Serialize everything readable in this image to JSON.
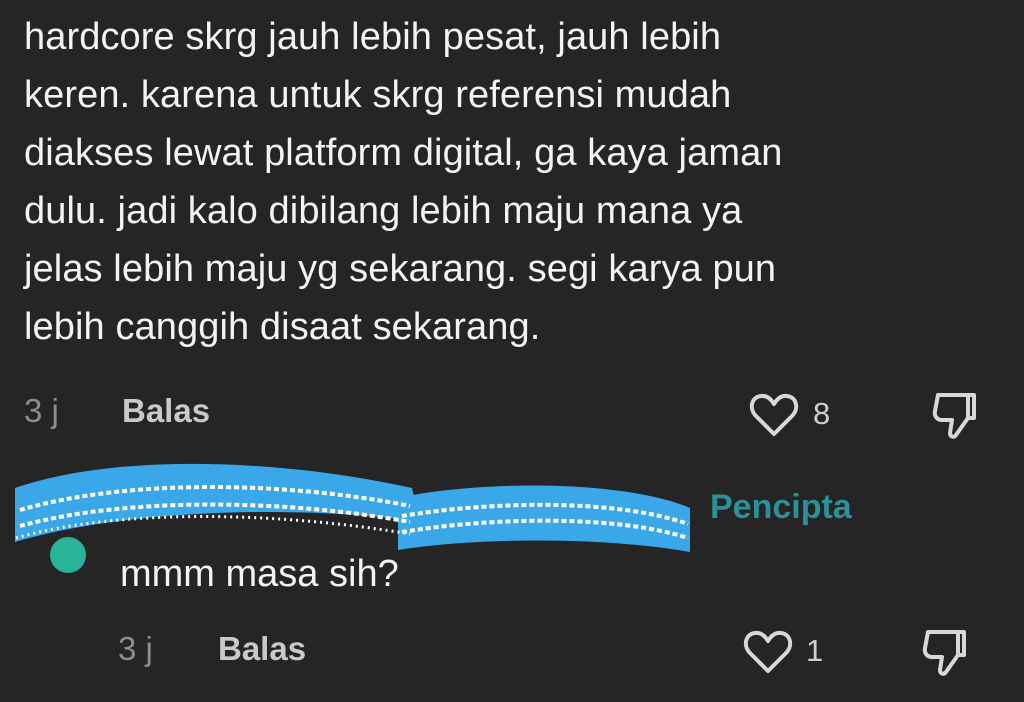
{
  "comment": {
    "text": "hardcore skrg jauh lebih pesat, jauh lebih\nkeren. karena untuk skrg referensi mudah\ndiakses lewat platform digital, ga kaya jaman\ndulu. jadi kalo dibilang lebih maju mana ya\njelas lebih maju yg sekarang. segi karya pun\nlebih canggih disaat sekarang.",
    "time": "3 j",
    "reply_label": "Balas",
    "likes": "8"
  },
  "reply": {
    "badge": "Pencipta",
    "text": "mmm masa sih?",
    "time": "3 j",
    "reply_label": "Balas",
    "likes": "1"
  },
  "icons": {
    "like": "heart-icon",
    "dislike": "thumbs-down-icon"
  },
  "colors": {
    "background": "#252525",
    "text": "#f3f3f3",
    "muted": "#8d8d8d",
    "creator": "#2d8f97",
    "redaction": "#3aa7e8"
  }
}
